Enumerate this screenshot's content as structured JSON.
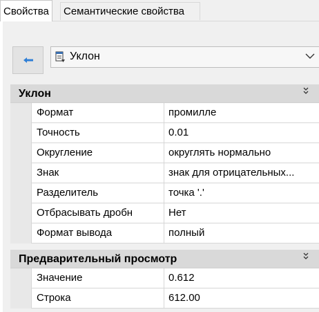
{
  "tabs": [
    {
      "label": "Свойства",
      "active": true
    },
    {
      "label": "Семантические свойства",
      "active": false
    }
  ],
  "selector": {
    "back_icon": "arrow-left-icon",
    "item_icon": "table-document-icon",
    "value": "Уклон"
  },
  "categories": [
    {
      "title": "Уклон",
      "rows": [
        {
          "label": "Формат",
          "value": "промилле"
        },
        {
          "label": "Точность",
          "value": "0.01"
        },
        {
          "label": "Округление",
          "value": "округлять нормально"
        },
        {
          "label": "Знак",
          "value": "знак для отрицательных..."
        },
        {
          "label": "Разделитель",
          "value": "точка '.'"
        },
        {
          "label": "Отбрасывать дробн",
          "value": "Нет"
        },
        {
          "label": "Формат вывода",
          "value": "полный"
        }
      ]
    },
    {
      "title": "Предварительный просмотр",
      "rows": [
        {
          "label": "Значение",
          "value": "0.612"
        },
        {
          "label": "Строка",
          "value": "612.00"
        }
      ]
    }
  ],
  "colors": {
    "category_bg": "#d9d9d9",
    "panel_bg": "#f0f0f0",
    "accent_arrow": "#2f7fd6"
  }
}
